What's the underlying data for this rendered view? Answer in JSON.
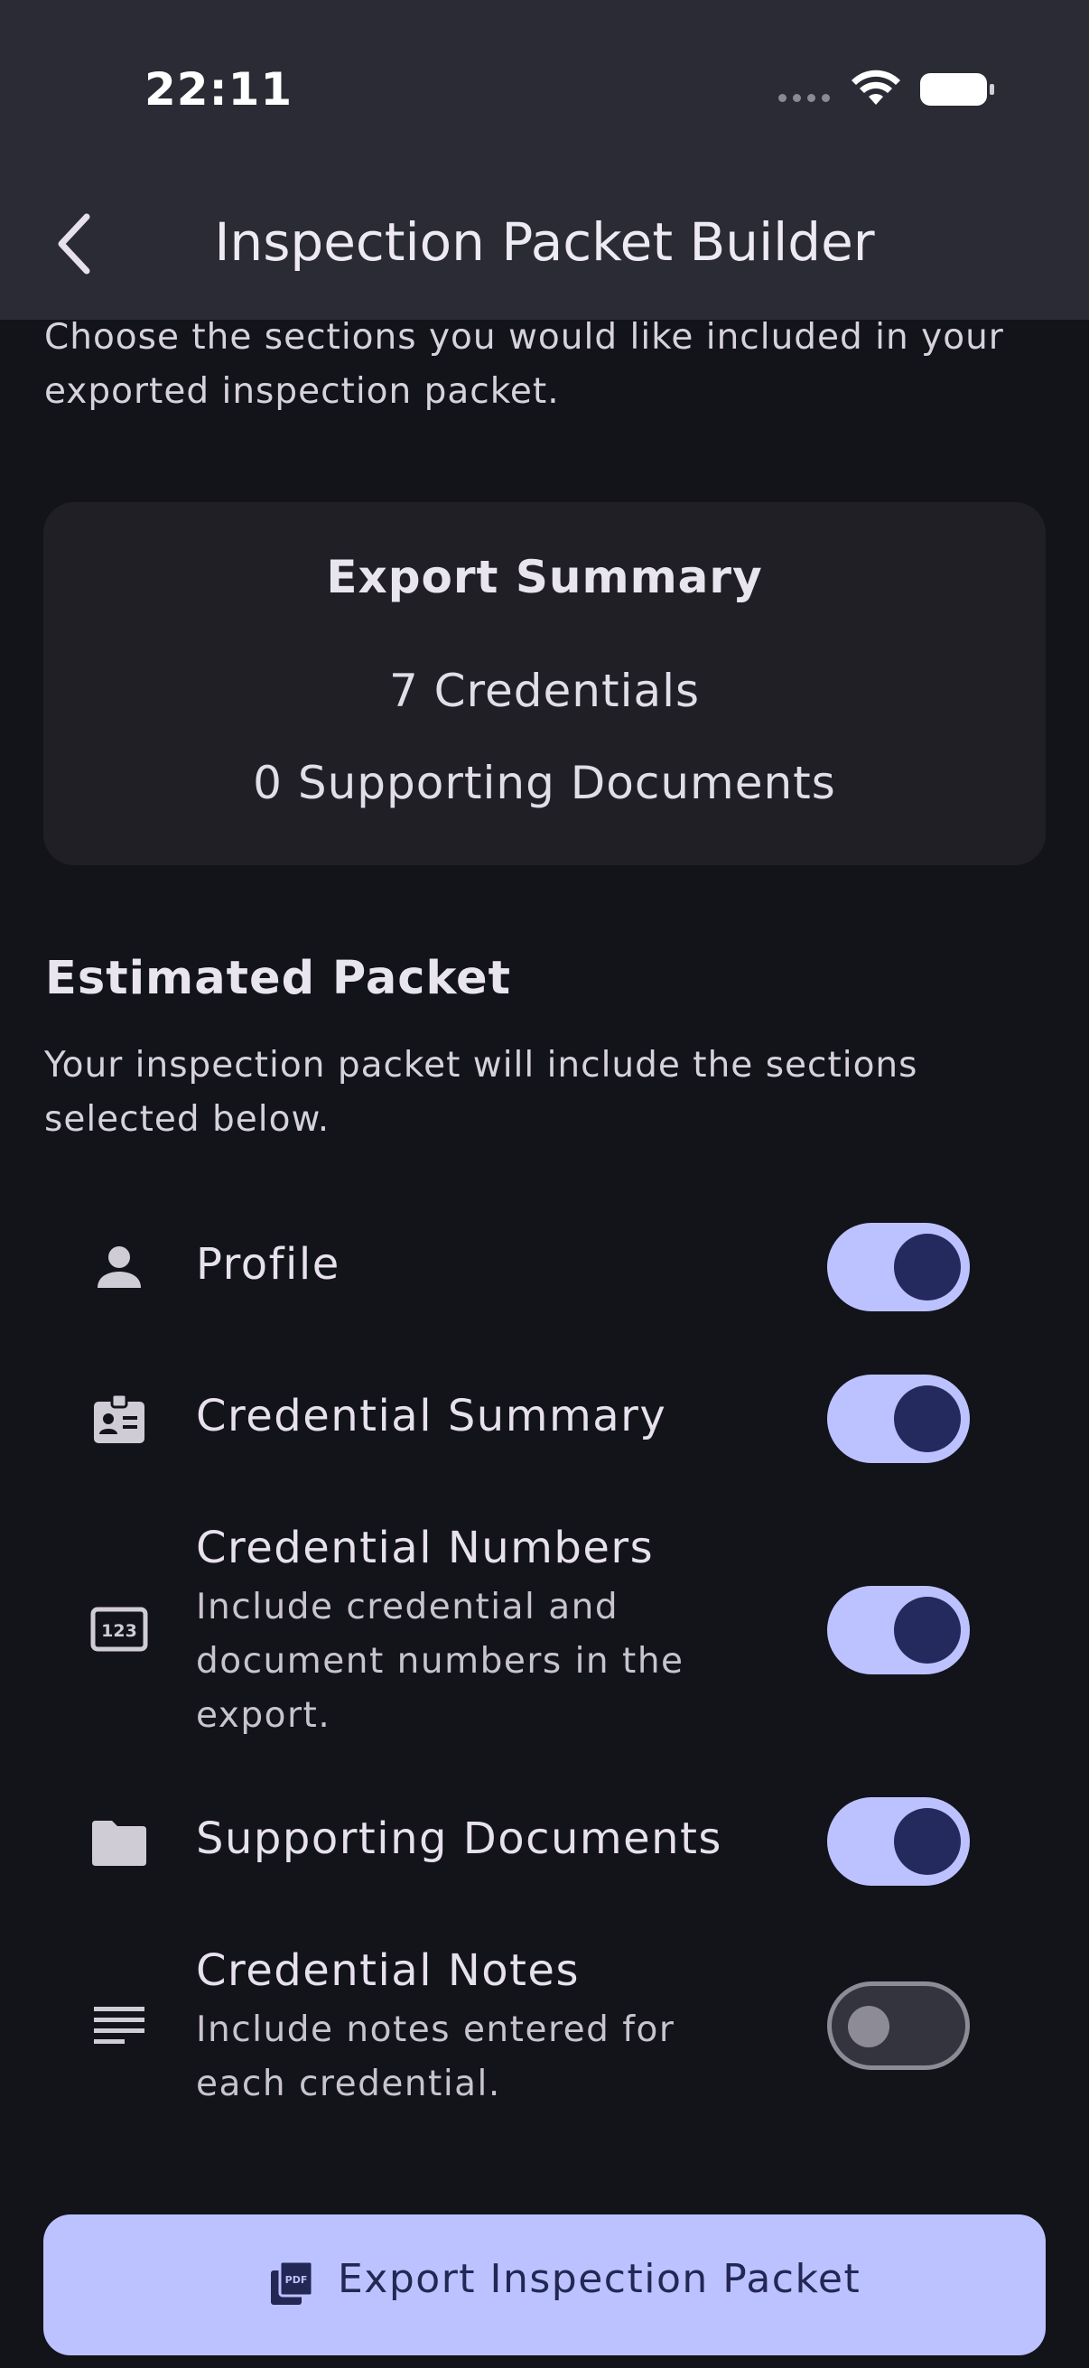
{
  "status_bar": {
    "time": "22:11"
  },
  "app_bar": {
    "title": "Inspection Packet Builder"
  },
  "intro": "Choose the sections you would like included in your exported inspection packet.",
  "summary": {
    "title": "Export Summary",
    "credentials": "7 Credentials",
    "documents": "0 Supporting Documents"
  },
  "estimated": {
    "title": "Estimated Packet",
    "description": "Your inspection packet will include the sections selected below."
  },
  "options": [
    {
      "label": "Profile",
      "icon": "person-icon",
      "enabled": true
    },
    {
      "label": "Credential Summary",
      "icon": "badge-icon",
      "enabled": true
    },
    {
      "label": "Credential Numbers",
      "subtitle": "Include credential and document numbers in the export.",
      "icon": "numbers-123-icon",
      "enabled": true
    },
    {
      "label": "Supporting Documents",
      "icon": "folder-icon",
      "enabled": true
    },
    {
      "label": "Credential Notes",
      "subtitle": "Include notes entered for each credential.",
      "icon": "notes-icon",
      "enabled": false
    }
  ],
  "export_button": {
    "label": "Export Inspection Packet",
    "icon": "pdf-icon"
  },
  "colors": {
    "background": "#13131a",
    "app_bar": "#2b2b35",
    "card": "#201f26",
    "accent": "#bcc2ff",
    "accent_dark": "#252a5e"
  }
}
